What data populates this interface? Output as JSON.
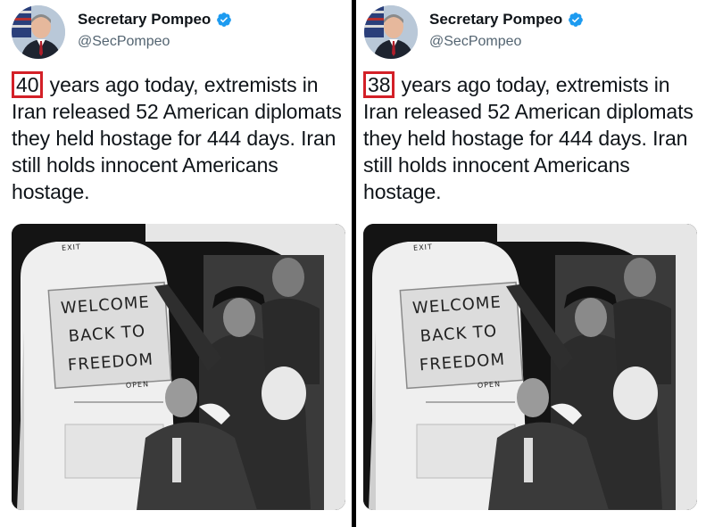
{
  "tweets": [
    {
      "display_name": "Secretary Pompeo",
      "handle": "@SecPompeo",
      "years": "40",
      "text_rest": " years ago today, extremists in Iran released 52 American diplomats they held hostage for 444 days. Iran still holds innocent Americans hostage.",
      "photo_sign_lines": [
        "WELCOME",
        "BACK TO",
        "FREEDOM"
      ],
      "photo_door_labels": [
        "EXIT",
        "OPEN"
      ]
    },
    {
      "display_name": "Secretary Pompeo",
      "handle": "@SecPompeo",
      "years": "38",
      "text_rest": " years ago today, extremists in Iran released 52 American diplomats they held hostage for 444 days. Iran still holds innocent Americans hostage.",
      "photo_sign_lines": [
        "WELCOME",
        "BACK TO",
        "FREEDOM"
      ],
      "photo_door_labels": [
        "EXIT",
        "OPEN"
      ]
    }
  ],
  "colors": {
    "highlight_box": "#d32027",
    "verified_badge": "#1d9bf0",
    "divider": "#000000",
    "handle_text": "#536471"
  },
  "icons": {
    "verified": "verified-badge-icon"
  }
}
